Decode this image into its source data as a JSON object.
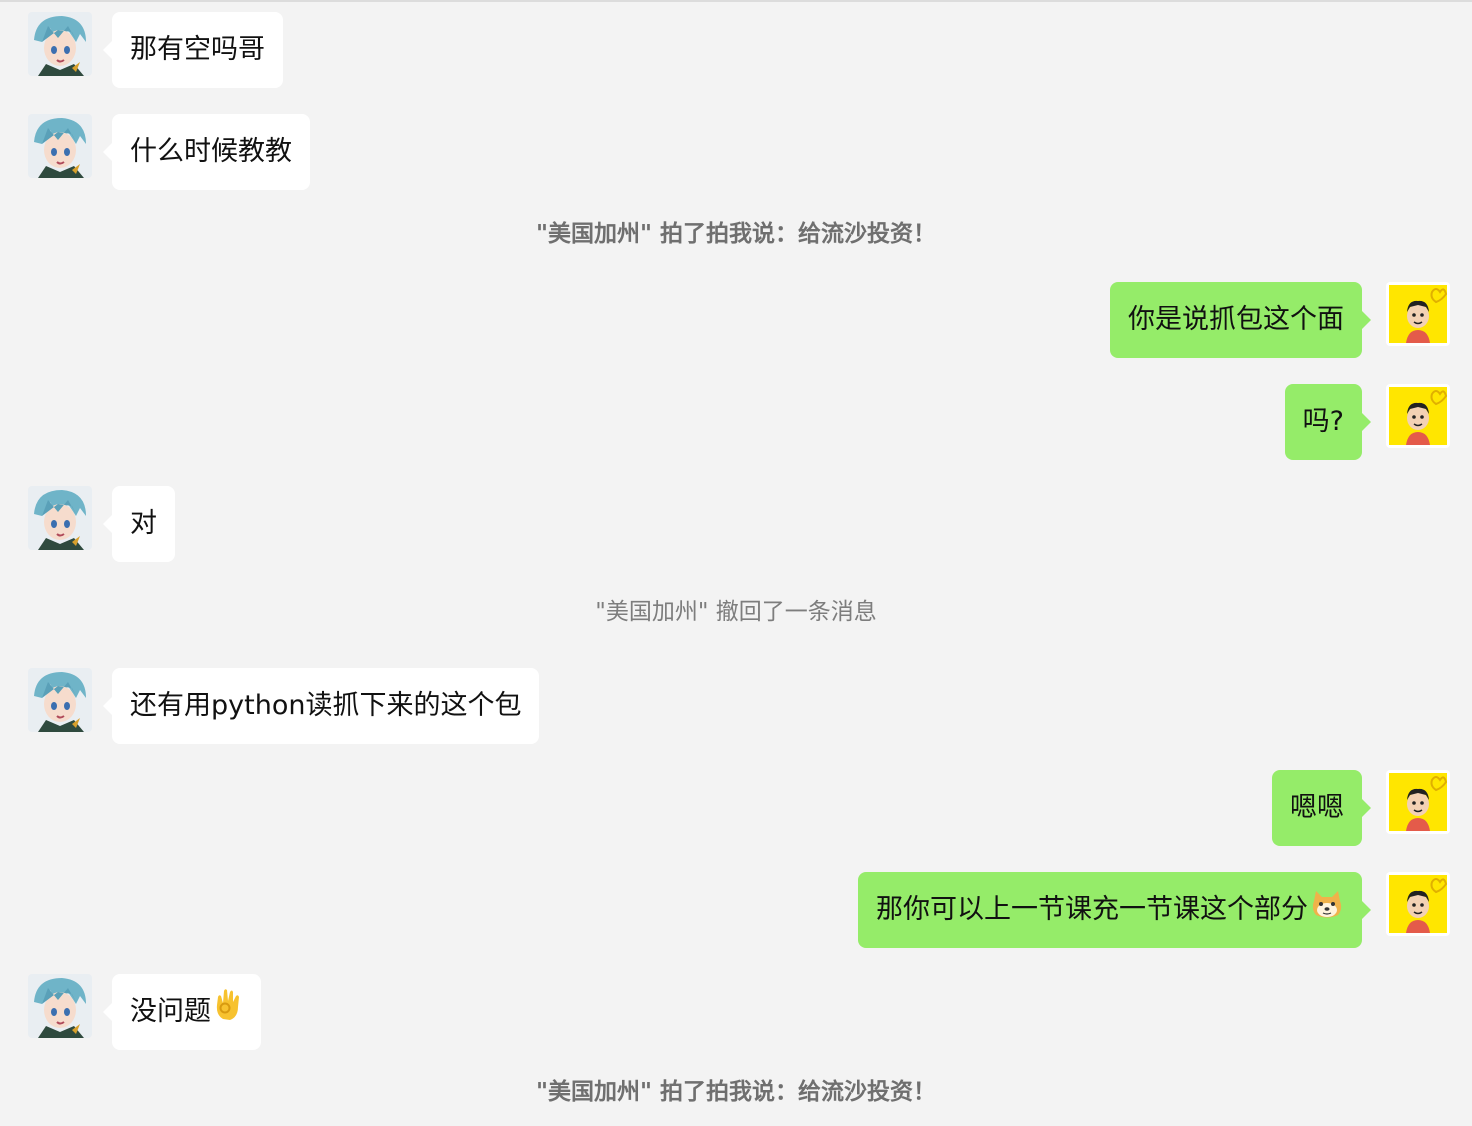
{
  "colors": {
    "background": "#f3f3f3",
    "incoming_bubble": "#ffffff",
    "outgoing_bubble": "#95ec69",
    "system_text": "#7d7d7d"
  },
  "messages": [
    {
      "side": "left",
      "text": "那有空吗哥",
      "avatar": "anime-avatar-icon"
    },
    {
      "side": "left",
      "text": "什么时候教教",
      "avatar": "anime-avatar-icon"
    },
    {
      "side": "system",
      "text": "\"美国加州\" 拍了拍我说：给流沙投资！"
    },
    {
      "side": "right",
      "text": "你是说抓包这个面",
      "avatar": "cartoon-avatar-icon"
    },
    {
      "side": "right",
      "text": "吗?",
      "avatar": "cartoon-avatar-icon"
    },
    {
      "side": "left",
      "text": "对",
      "avatar": "anime-avatar-icon"
    },
    {
      "side": "system",
      "text": "\"美国加州\" 撤回了一条消息"
    },
    {
      "side": "left",
      "text": "还有用python读抓下来的这个包",
      "avatar": "anime-avatar-icon"
    },
    {
      "side": "right",
      "text": "嗯嗯",
      "avatar": "cartoon-avatar-icon"
    },
    {
      "side": "right",
      "text": "那你可以上一节课充一节课这个部分",
      "avatar": "cartoon-avatar-icon",
      "emoji": "doge-emoji-icon"
    },
    {
      "side": "left",
      "text": "没问题",
      "avatar": "anime-avatar-icon",
      "emoji": "ok-hand-emoji-icon"
    },
    {
      "side": "system",
      "text": "\"美国加州\" 拍了拍我说：给流沙投资！"
    }
  ]
}
